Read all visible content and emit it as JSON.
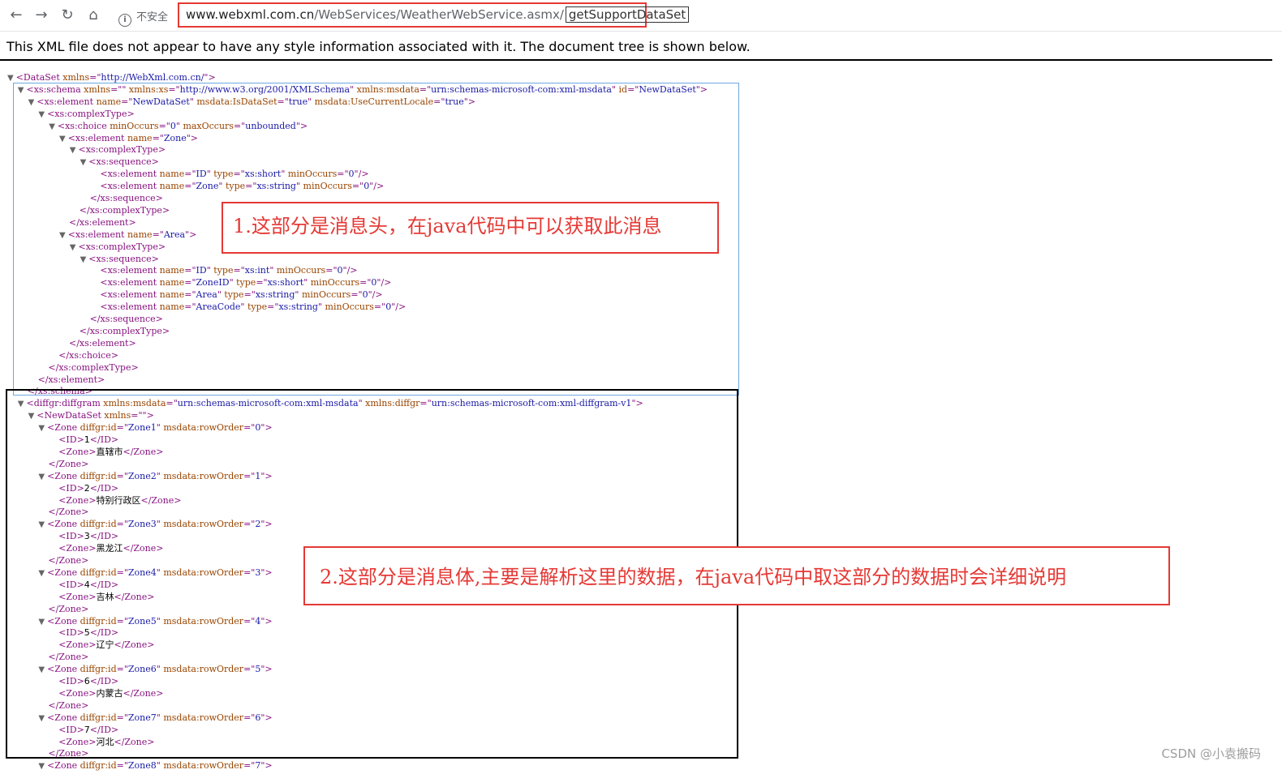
{
  "browser": {
    "security_label": "不安全",
    "url_host": "www.webxml.com.cn",
    "url_path": "/WebServices/WeatherWebService.asmx/",
    "url_selected": "getSupportDataSet"
  },
  "notice": "This XML file does not appear to have any style information associated with it. The document tree is shown below.",
  "annotations": {
    "header_note": "1.这部分是消息头，在java代码中可以获取此消息",
    "body_note": "2.这部分是消息体,主要是解析这里的数据，在java代码中取这部分的数据时会详细说明"
  },
  "watermark": "CSDN @小袁搬码",
  "xml_lines": [
    {
      "i": 0,
      "t": true,
      "s": [
        [
          "tg",
          "<DataSet "
        ],
        [
          "an",
          "xmlns"
        ],
        [
          "tg",
          "=\""
        ],
        [
          "av",
          "http://WebXml.com.cn/"
        ],
        [
          "tg",
          "\">"
        ]
      ]
    },
    {
      "i": 1,
      "t": true,
      "s": [
        [
          "tg",
          "<xs:schema "
        ],
        [
          "an",
          "xmlns"
        ],
        [
          "tg",
          "=\"\" "
        ],
        [
          "an",
          "xmlns:xs"
        ],
        [
          "tg",
          "=\""
        ],
        [
          "av",
          "http://www.w3.org/2001/XMLSchema"
        ],
        [
          "tg",
          "\" "
        ],
        [
          "an",
          "xmlns:msdata"
        ],
        [
          "tg",
          "=\""
        ],
        [
          "av",
          "urn:schemas-microsoft-com:xml-msdata"
        ],
        [
          "tg",
          "\" "
        ],
        [
          "an",
          "id"
        ],
        [
          "tg",
          "=\""
        ],
        [
          "av",
          "NewDataSet"
        ],
        [
          "tg",
          "\">"
        ]
      ]
    },
    {
      "i": 2,
      "t": true,
      "s": [
        [
          "tg",
          "<xs:element "
        ],
        [
          "an",
          "name"
        ],
        [
          "tg",
          "=\""
        ],
        [
          "av",
          "NewDataSet"
        ],
        [
          "tg",
          "\" "
        ],
        [
          "an",
          "msdata:IsDataSet"
        ],
        [
          "tg",
          "=\""
        ],
        [
          "av",
          "true"
        ],
        [
          "tg",
          "\" "
        ],
        [
          "an",
          "msdata:UseCurrentLocale"
        ],
        [
          "tg",
          "=\""
        ],
        [
          "av",
          "true"
        ],
        [
          "tg",
          "\">"
        ]
      ]
    },
    {
      "i": 3,
      "t": true,
      "s": [
        [
          "tg",
          "<xs:complexType>"
        ]
      ]
    },
    {
      "i": 4,
      "t": true,
      "s": [
        [
          "tg",
          "<xs:choice "
        ],
        [
          "an",
          "minOccurs"
        ],
        [
          "tg",
          "=\""
        ],
        [
          "av",
          "0"
        ],
        [
          "tg",
          "\" "
        ],
        [
          "an",
          "maxOccurs"
        ],
        [
          "tg",
          "=\""
        ],
        [
          "av",
          "unbounded"
        ],
        [
          "tg",
          "\">"
        ]
      ]
    },
    {
      "i": 5,
      "t": true,
      "s": [
        [
          "tg",
          "<xs:element "
        ],
        [
          "an",
          "name"
        ],
        [
          "tg",
          "=\""
        ],
        [
          "av",
          "Zone"
        ],
        [
          "tg",
          "\">"
        ]
      ]
    },
    {
      "i": 6,
      "t": true,
      "s": [
        [
          "tg",
          "<xs:complexType>"
        ]
      ]
    },
    {
      "i": 7,
      "t": true,
      "s": [
        [
          "tg",
          "<xs:sequence>"
        ]
      ]
    },
    {
      "i": 8,
      "t": false,
      "s": [
        [
          "tg",
          "<xs:element "
        ],
        [
          "an",
          "name"
        ],
        [
          "tg",
          "=\""
        ],
        [
          "av",
          "ID"
        ],
        [
          "tg",
          "\" "
        ],
        [
          "an",
          "type"
        ],
        [
          "tg",
          "=\""
        ],
        [
          "av",
          "xs:short"
        ],
        [
          "tg",
          "\" "
        ],
        [
          "an",
          "minOccurs"
        ],
        [
          "tg",
          "=\""
        ],
        [
          "av",
          "0"
        ],
        [
          "tg",
          "\"/>"
        ]
      ]
    },
    {
      "i": 8,
      "t": false,
      "s": [
        [
          "tg",
          "<xs:element "
        ],
        [
          "an",
          "name"
        ],
        [
          "tg",
          "=\""
        ],
        [
          "av",
          "Zone"
        ],
        [
          "tg",
          "\" "
        ],
        [
          "an",
          "type"
        ],
        [
          "tg",
          "=\""
        ],
        [
          "av",
          "xs:string"
        ],
        [
          "tg",
          "\" "
        ],
        [
          "an",
          "minOccurs"
        ],
        [
          "tg",
          "=\""
        ],
        [
          "av",
          "0"
        ],
        [
          "tg",
          "\"/>"
        ]
      ]
    },
    {
      "i": 7,
      "t": false,
      "s": [
        [
          "tg",
          "</xs:sequence>"
        ]
      ]
    },
    {
      "i": 6,
      "t": false,
      "s": [
        [
          "tg",
          "</xs:complexType>"
        ]
      ]
    },
    {
      "i": 5,
      "t": false,
      "s": [
        [
          "tg",
          "</xs:element>"
        ]
      ]
    },
    {
      "i": 5,
      "t": true,
      "s": [
        [
          "tg",
          "<xs:element "
        ],
        [
          "an",
          "name"
        ],
        [
          "tg",
          "=\""
        ],
        [
          "av",
          "Area"
        ],
        [
          "tg",
          "\">"
        ]
      ]
    },
    {
      "i": 6,
      "t": true,
      "s": [
        [
          "tg",
          "<xs:complexType>"
        ]
      ]
    },
    {
      "i": 7,
      "t": true,
      "s": [
        [
          "tg",
          "<xs:sequence>"
        ]
      ]
    },
    {
      "i": 8,
      "t": false,
      "s": [
        [
          "tg",
          "<xs:element "
        ],
        [
          "an",
          "name"
        ],
        [
          "tg",
          "=\""
        ],
        [
          "av",
          "ID"
        ],
        [
          "tg",
          "\" "
        ],
        [
          "an",
          "type"
        ],
        [
          "tg",
          "=\""
        ],
        [
          "av",
          "xs:int"
        ],
        [
          "tg",
          "\" "
        ],
        [
          "an",
          "minOccurs"
        ],
        [
          "tg",
          "=\""
        ],
        [
          "av",
          "0"
        ],
        [
          "tg",
          "\"/>"
        ]
      ]
    },
    {
      "i": 8,
      "t": false,
      "s": [
        [
          "tg",
          "<xs:element "
        ],
        [
          "an",
          "name"
        ],
        [
          "tg",
          "=\""
        ],
        [
          "av",
          "ZoneID"
        ],
        [
          "tg",
          "\" "
        ],
        [
          "an",
          "type"
        ],
        [
          "tg",
          "=\""
        ],
        [
          "av",
          "xs:short"
        ],
        [
          "tg",
          "\" "
        ],
        [
          "an",
          "minOccurs"
        ],
        [
          "tg",
          "=\""
        ],
        [
          "av",
          "0"
        ],
        [
          "tg",
          "\"/>"
        ]
      ]
    },
    {
      "i": 8,
      "t": false,
      "s": [
        [
          "tg",
          "<xs:element "
        ],
        [
          "an",
          "name"
        ],
        [
          "tg",
          "=\""
        ],
        [
          "av",
          "Area"
        ],
        [
          "tg",
          "\" "
        ],
        [
          "an",
          "type"
        ],
        [
          "tg",
          "=\""
        ],
        [
          "av",
          "xs:string"
        ],
        [
          "tg",
          "\" "
        ],
        [
          "an",
          "minOccurs"
        ],
        [
          "tg",
          "=\""
        ],
        [
          "av",
          "0"
        ],
        [
          "tg",
          "\"/>"
        ]
      ]
    },
    {
      "i": 8,
      "t": false,
      "s": [
        [
          "tg",
          "<xs:element "
        ],
        [
          "an",
          "name"
        ],
        [
          "tg",
          "=\""
        ],
        [
          "av",
          "AreaCode"
        ],
        [
          "tg",
          "\" "
        ],
        [
          "an",
          "type"
        ],
        [
          "tg",
          "=\""
        ],
        [
          "av",
          "xs:string"
        ],
        [
          "tg",
          "\" "
        ],
        [
          "an",
          "minOccurs"
        ],
        [
          "tg",
          "=\""
        ],
        [
          "av",
          "0"
        ],
        [
          "tg",
          "\"/>"
        ]
      ]
    },
    {
      "i": 7,
      "t": false,
      "s": [
        [
          "tg",
          "</xs:sequence>"
        ]
      ]
    },
    {
      "i": 6,
      "t": false,
      "s": [
        [
          "tg",
          "</xs:complexType>"
        ]
      ]
    },
    {
      "i": 5,
      "t": false,
      "s": [
        [
          "tg",
          "</xs:element>"
        ]
      ]
    },
    {
      "i": 4,
      "t": false,
      "s": [
        [
          "tg",
          "</xs:choice>"
        ]
      ]
    },
    {
      "i": 3,
      "t": false,
      "s": [
        [
          "tg",
          "</xs:complexType>"
        ]
      ]
    },
    {
      "i": 2,
      "t": false,
      "s": [
        [
          "tg",
          "</xs:element>"
        ]
      ]
    },
    {
      "i": 1,
      "t": false,
      "s": [
        [
          "tg",
          "</xs:schema>"
        ]
      ]
    },
    {
      "i": 1,
      "t": true,
      "s": [
        [
          "tg",
          "<diffgr:diffgram "
        ],
        [
          "an",
          "xmlns:msdata"
        ],
        [
          "tg",
          "=\""
        ],
        [
          "av",
          "urn:schemas-microsoft-com:xml-msdata"
        ],
        [
          "tg",
          "\" "
        ],
        [
          "an",
          "xmlns:diffgr"
        ],
        [
          "tg",
          "=\""
        ],
        [
          "av",
          "urn:schemas-microsoft-com:xml-diffgram-v1"
        ],
        [
          "tg",
          "\">"
        ]
      ]
    },
    {
      "i": 2,
      "t": true,
      "s": [
        [
          "tg",
          "<NewDataSet "
        ],
        [
          "an",
          "xmlns"
        ],
        [
          "tg",
          "=\"\">"
        ]
      ]
    },
    {
      "i": 3,
      "t": true,
      "s": [
        [
          "tg",
          "<Zone "
        ],
        [
          "an",
          "diffgr:id"
        ],
        [
          "tg",
          "=\""
        ],
        [
          "av",
          "Zone1"
        ],
        [
          "tg",
          "\" "
        ],
        [
          "an",
          "msdata:rowOrder"
        ],
        [
          "tg",
          "=\""
        ],
        [
          "av",
          "0"
        ],
        [
          "tg",
          "\">"
        ]
      ]
    },
    {
      "i": 4,
      "t": false,
      "s": [
        [
          "tg",
          "<ID>"
        ],
        [
          "tx",
          "1"
        ],
        [
          "tg",
          "</ID>"
        ]
      ]
    },
    {
      "i": 4,
      "t": false,
      "s": [
        [
          "tg",
          "<Zone>"
        ],
        [
          "tx",
          "直辖市"
        ],
        [
          "tg",
          "</Zone>"
        ]
      ]
    },
    {
      "i": 3,
      "t": false,
      "s": [
        [
          "tg",
          "</Zone>"
        ]
      ]
    },
    {
      "i": 3,
      "t": true,
      "s": [
        [
          "tg",
          "<Zone "
        ],
        [
          "an",
          "diffgr:id"
        ],
        [
          "tg",
          "=\""
        ],
        [
          "av",
          "Zone2"
        ],
        [
          "tg",
          "\" "
        ],
        [
          "an",
          "msdata:rowOrder"
        ],
        [
          "tg",
          "=\""
        ],
        [
          "av",
          "1"
        ],
        [
          "tg",
          "\">"
        ]
      ]
    },
    {
      "i": 4,
      "t": false,
      "s": [
        [
          "tg",
          "<ID>"
        ],
        [
          "tx",
          "2"
        ],
        [
          "tg",
          "</ID>"
        ]
      ]
    },
    {
      "i": 4,
      "t": false,
      "s": [
        [
          "tg",
          "<Zone>"
        ],
        [
          "tx",
          "特别行政区"
        ],
        [
          "tg",
          "</Zone>"
        ]
      ]
    },
    {
      "i": 3,
      "t": false,
      "s": [
        [
          "tg",
          "</Zone>"
        ]
      ]
    },
    {
      "i": 3,
      "t": true,
      "s": [
        [
          "tg",
          "<Zone "
        ],
        [
          "an",
          "diffgr:id"
        ],
        [
          "tg",
          "=\""
        ],
        [
          "av",
          "Zone3"
        ],
        [
          "tg",
          "\" "
        ],
        [
          "an",
          "msdata:rowOrder"
        ],
        [
          "tg",
          "=\""
        ],
        [
          "av",
          "2"
        ],
        [
          "tg",
          "\">"
        ]
      ]
    },
    {
      "i": 4,
      "t": false,
      "s": [
        [
          "tg",
          "<ID>"
        ],
        [
          "tx",
          "3"
        ],
        [
          "tg",
          "</ID>"
        ]
      ]
    },
    {
      "i": 4,
      "t": false,
      "s": [
        [
          "tg",
          "<Zone>"
        ],
        [
          "tx",
          "黑龙江"
        ],
        [
          "tg",
          "</Zone>"
        ]
      ]
    },
    {
      "i": 3,
      "t": false,
      "s": [
        [
          "tg",
          "</Zone>"
        ]
      ]
    },
    {
      "i": 3,
      "t": true,
      "s": [
        [
          "tg",
          "<Zone "
        ],
        [
          "an",
          "diffgr:id"
        ],
        [
          "tg",
          "=\""
        ],
        [
          "av",
          "Zone4"
        ],
        [
          "tg",
          "\" "
        ],
        [
          "an",
          "msdata:rowOrder"
        ],
        [
          "tg",
          "=\""
        ],
        [
          "av",
          "3"
        ],
        [
          "tg",
          "\">"
        ]
      ]
    },
    {
      "i": 4,
      "t": false,
      "s": [
        [
          "tg",
          "<ID>"
        ],
        [
          "tx",
          "4"
        ],
        [
          "tg",
          "</ID>"
        ]
      ]
    },
    {
      "i": 4,
      "t": false,
      "s": [
        [
          "tg",
          "<Zone>"
        ],
        [
          "tx",
          "吉林"
        ],
        [
          "tg",
          "</Zone>"
        ]
      ]
    },
    {
      "i": 3,
      "t": false,
      "s": [
        [
          "tg",
          "</Zone>"
        ]
      ]
    },
    {
      "i": 3,
      "t": true,
      "s": [
        [
          "tg",
          "<Zone "
        ],
        [
          "an",
          "diffgr:id"
        ],
        [
          "tg",
          "=\""
        ],
        [
          "av",
          "Zone5"
        ],
        [
          "tg",
          "\" "
        ],
        [
          "an",
          "msdata:rowOrder"
        ],
        [
          "tg",
          "=\""
        ],
        [
          "av",
          "4"
        ],
        [
          "tg",
          "\">"
        ]
      ]
    },
    {
      "i": 4,
      "t": false,
      "s": [
        [
          "tg",
          "<ID>"
        ],
        [
          "tx",
          "5"
        ],
        [
          "tg",
          "</ID>"
        ]
      ]
    },
    {
      "i": 4,
      "t": false,
      "s": [
        [
          "tg",
          "<Zone>"
        ],
        [
          "tx",
          "辽宁"
        ],
        [
          "tg",
          "</Zone>"
        ]
      ]
    },
    {
      "i": 3,
      "t": false,
      "s": [
        [
          "tg",
          "</Zone>"
        ]
      ]
    },
    {
      "i": 3,
      "t": true,
      "s": [
        [
          "tg",
          "<Zone "
        ],
        [
          "an",
          "diffgr:id"
        ],
        [
          "tg",
          "=\""
        ],
        [
          "av",
          "Zone6"
        ],
        [
          "tg",
          "\" "
        ],
        [
          "an",
          "msdata:rowOrder"
        ],
        [
          "tg",
          "=\""
        ],
        [
          "av",
          "5"
        ],
        [
          "tg",
          "\">"
        ]
      ]
    },
    {
      "i": 4,
      "t": false,
      "s": [
        [
          "tg",
          "<ID>"
        ],
        [
          "tx",
          "6"
        ],
        [
          "tg",
          "</ID>"
        ]
      ]
    },
    {
      "i": 4,
      "t": false,
      "s": [
        [
          "tg",
          "<Zone>"
        ],
        [
          "tx",
          "内蒙古"
        ],
        [
          "tg",
          "</Zone>"
        ]
      ]
    },
    {
      "i": 3,
      "t": false,
      "s": [
        [
          "tg",
          "</Zone>"
        ]
      ]
    },
    {
      "i": 3,
      "t": true,
      "s": [
        [
          "tg",
          "<Zone "
        ],
        [
          "an",
          "diffgr:id"
        ],
        [
          "tg",
          "=\""
        ],
        [
          "av",
          "Zone7"
        ],
        [
          "tg",
          "\" "
        ],
        [
          "an",
          "msdata:rowOrder"
        ],
        [
          "tg",
          "=\""
        ],
        [
          "av",
          "6"
        ],
        [
          "tg",
          "\">"
        ]
      ]
    },
    {
      "i": 4,
      "t": false,
      "s": [
        [
          "tg",
          "<ID>"
        ],
        [
          "tx",
          "7"
        ],
        [
          "tg",
          "</ID>"
        ]
      ]
    },
    {
      "i": 4,
      "t": false,
      "s": [
        [
          "tg",
          "<Zone>"
        ],
        [
          "tx",
          "河北"
        ],
        [
          "tg",
          "</Zone>"
        ]
      ]
    },
    {
      "i": 3,
      "t": false,
      "s": [
        [
          "tg",
          "</Zone>"
        ]
      ]
    },
    {
      "i": 3,
      "t": true,
      "s": [
        [
          "tg",
          "<Zone "
        ],
        [
          "an",
          "diffgr:id"
        ],
        [
          "tg",
          "=\""
        ],
        [
          "av",
          "Zone8"
        ],
        [
          "tg",
          "\" "
        ],
        [
          "an",
          "msdata:rowOrder"
        ],
        [
          "tg",
          "=\""
        ],
        [
          "av",
          "7"
        ],
        [
          "tg",
          "\">"
        ]
      ]
    }
  ]
}
